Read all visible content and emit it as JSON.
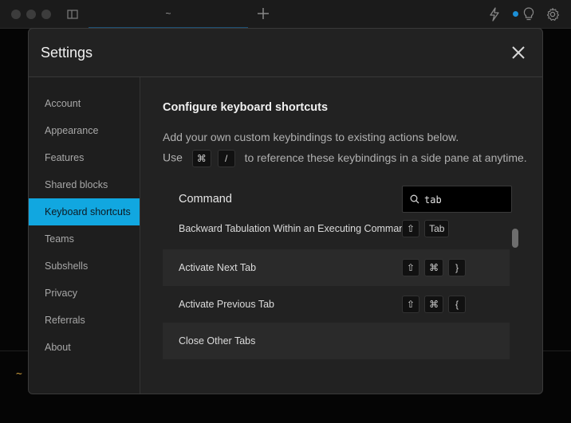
{
  "window": {
    "tab_title": "~",
    "prompt": "~"
  },
  "modal": {
    "title": "Settings"
  },
  "sidebar": {
    "items": [
      {
        "label": "Account"
      },
      {
        "label": "Appearance"
      },
      {
        "label": "Features"
      },
      {
        "label": "Shared blocks"
      },
      {
        "label": "Keyboard shortcuts",
        "active": true
      },
      {
        "label": "Teams"
      },
      {
        "label": "Subshells"
      },
      {
        "label": "Privacy"
      },
      {
        "label": "Referrals"
      },
      {
        "label": "About"
      }
    ]
  },
  "content": {
    "title": "Configure keyboard shortcuts",
    "desc_line1": "Add your own custom keybindings to existing actions below.",
    "desc_use": "Use",
    "desc_key1": "⌘",
    "desc_key2": "/",
    "desc_rest": "to reference these keybindings in a side pane at anytime.",
    "column_header": "Command",
    "search": {
      "value": "tab",
      "placeholder": ""
    },
    "rows": [
      {
        "label": "Backward Tabulation Within an Executing Command",
        "keys": [
          "⇧",
          "Tab"
        ]
      },
      {
        "label": "Activate Next Tab",
        "keys": [
          "⇧",
          "⌘",
          "}"
        ]
      },
      {
        "label": "Activate Previous Tab",
        "keys": [
          "⇧",
          "⌘",
          "{"
        ]
      },
      {
        "label": "Close Other Tabs",
        "keys": []
      }
    ]
  },
  "colors": {
    "accent": "#11a7e0",
    "background": "#222222",
    "sidebar": "#1e1e1e"
  }
}
